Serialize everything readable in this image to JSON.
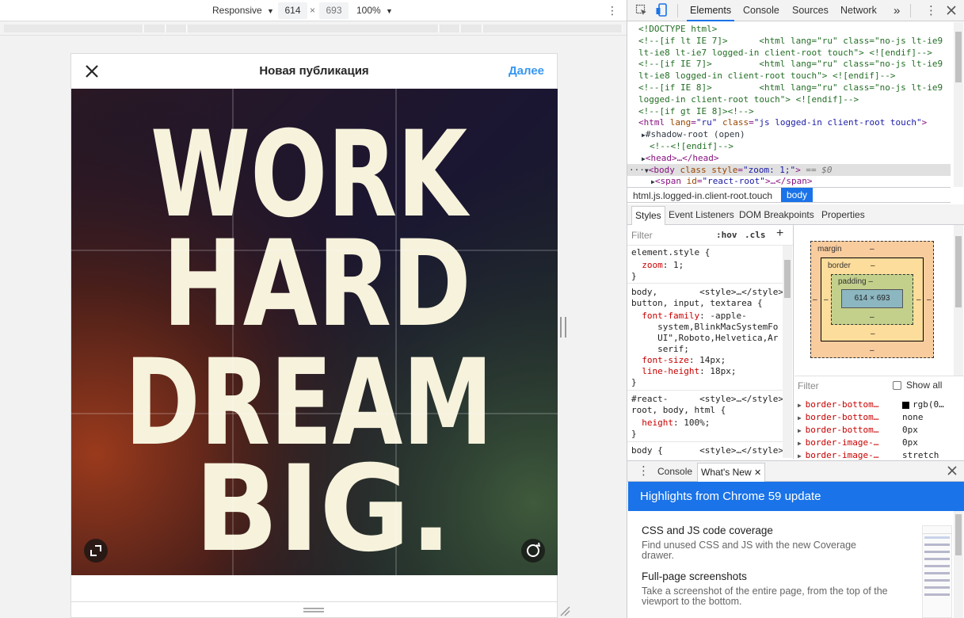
{
  "device_toolbar": {
    "device": "Responsive",
    "width": "614",
    "times": "×",
    "height": "693",
    "zoom": "100%"
  },
  "post": {
    "title": "Новая публикация",
    "next": "Далее",
    "image_text": [
      "WORK",
      "HARD",
      "DREAM",
      "BIG."
    ]
  },
  "devtools": {
    "tabs": [
      "Elements",
      "Console",
      "Sources",
      "Network"
    ],
    "more": "»",
    "elements_lines": [
      {
        "cls": "cmt",
        "text": "<!DOCTYPE html>"
      },
      {
        "cls": "cmt",
        "text": "<!--[if lt IE 7]>      <html lang=\"ru\" class=\"no-js lt-ie9"
      },
      {
        "cls": "cmt",
        "text": "lt-ie8 lt-ie7 logged-in client-root touch\"> <![endif]-->"
      },
      {
        "cls": "cmt",
        "text": "<!--[if IE 7]>         <html lang=\"ru\" class=\"no-js lt-ie9"
      },
      {
        "cls": "cmt",
        "text": "lt-ie8 logged-in client-root touch\"> <![endif]-->"
      },
      {
        "cls": "cmt",
        "text": "<!--[if IE 8]>         <html lang=\"ru\" class=\"no-js lt-ie9"
      },
      {
        "cls": "cmt",
        "text": "logged-in client-root touch\"> <![endif]-->"
      },
      {
        "cls": "cmt",
        "text": "<!--[if gt IE 8]><!-->"
      }
    ],
    "html_line": {
      "open": "<html ",
      "a1": "lang",
      "v1": "\"ru\"",
      "a2": "class",
      "v2": "\"js logged-in client-root touch\"",
      "close": ">"
    },
    "shadow_root": "#shadow-root (open)",
    "endif": "<!--<![endif]-->",
    "head": "<head>…</head>",
    "body_line": {
      "prefix": "···",
      "open": "<body ",
      "a1": "class",
      "a2": "style",
      "v2": "\"zoom: 1;\"",
      "close": ">",
      "tail": " == $0"
    },
    "span_line": {
      "open": "<span ",
      "a1": "id",
      "v1": "\"react-root\"",
      "close": ">…</span>"
    },
    "breadcrumbs": [
      "html.js.logged-in.client-root.touch",
      "body"
    ],
    "styles_tabs": [
      "Styles",
      "Event Listeners",
      "DOM Breakpoints",
      "Properties"
    ],
    "filter_placeholder": "Filter",
    "hov": ":hov",
    "cls": ".cls",
    "plus": "+",
    "styles_lines": [
      {
        "text": "element.style {",
        "cls": ""
      },
      {
        "text": "  zoom: 1;",
        "prop": "zoom",
        "value": "1;"
      },
      {
        "text": "}",
        "cls": ""
      },
      {
        "text": "body,        <style>…</style>",
        "cls": ""
      },
      {
        "text": "button, input, textarea {",
        "cls": ""
      },
      {
        "text": "  font-family: -apple-",
        "prop": "font-family",
        "value": "-apple-"
      },
      {
        "text": "     system,BlinkMacSystemFo",
        "cls": "cont"
      },
      {
        "text": "     UI\",Roboto,Helvetica,Ar",
        "cls": "cont"
      },
      {
        "text": "     serif;",
        "cls": "cont"
      },
      {
        "text": "  font-size: 14px;",
        "prop": "font-size",
        "value": "14px;"
      },
      {
        "text": "  line-height: 18px;",
        "prop": "line-height",
        "value": "18px;"
      },
      {
        "text": "}",
        "cls": ""
      },
      {
        "text": "#react-      <style>…</style>",
        "cls": ""
      },
      {
        "text": "root, body, html {",
        "cls": ""
      },
      {
        "text": "  height: 100%;",
        "prop": "height",
        "value": "100%;"
      },
      {
        "text": "}",
        "cls": ""
      },
      {
        "text": "body {       <style>…</style>",
        "cls": ""
      }
    ],
    "box_model": {
      "margin": "margin",
      "border": "border",
      "padding": "padding",
      "content": "614 × 693",
      "dash": "–"
    },
    "computed_filter": "Filter",
    "show_all": "Show all",
    "computed": [
      {
        "name": "border-bottom…",
        "value": "rgb(0…"
      },
      {
        "name": "border-bottom…",
        "value": "none"
      },
      {
        "name": "border-bottom…",
        "value": "0px"
      },
      {
        "name": "border-image-…",
        "value": "0px"
      },
      {
        "name": "border-image-…",
        "value": "stretch"
      }
    ],
    "drawer_tabs": [
      "Console",
      "What's New"
    ],
    "whats_new": {
      "banner": "Highlights from Chrome 59 update",
      "items": [
        {
          "title": "CSS and JS code coverage",
          "desc": "Find unused CSS and JS with the new Coverage drawer."
        },
        {
          "title": "Full-page screenshots",
          "desc": "Take a screenshot of the entire page, from the top of the viewport to the bottom."
        }
      ]
    }
  },
  "colors": {
    "accent": "#1a73e8",
    "link_blue": "#3897f0",
    "margin_box": "#f9cc9d",
    "border_box": "#fddd9b",
    "padding_box": "#c3d08b",
    "content_box": "#8cb6c0"
  }
}
